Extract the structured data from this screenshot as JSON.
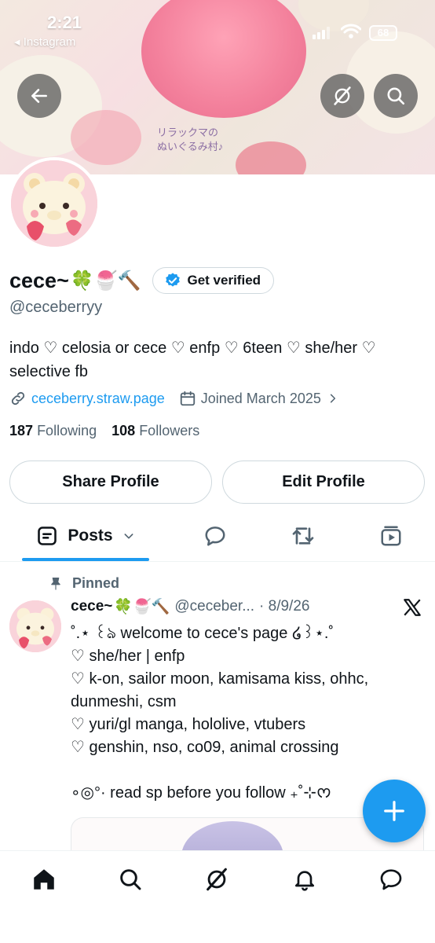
{
  "status_bar": {
    "time": "2:21",
    "back_app": "◂ Instagram",
    "battery": "68"
  },
  "banner": {
    "caption": "リラックマの\nぬいぐるみ村♪"
  },
  "profile": {
    "name": "cece~",
    "name_emojis": "🍀🍧🔨",
    "verify_label": "Get verified",
    "handle": "@ceceberryy",
    "bio": "indo ♡ celosia or cece ♡ enfp ♡ 6teen ♡ she/her ♡ selective fb",
    "link": "ceceberry.straw.page",
    "joined": "Joined March 2025",
    "following_count": "187",
    "following_label": "Following",
    "followers_count": "108",
    "followers_label": "Followers"
  },
  "buttons": {
    "share": "Share Profile",
    "edit": "Edit Profile"
  },
  "tabs": {
    "posts": "Posts"
  },
  "post": {
    "pinned_label": "Pinned",
    "author_name": "cece~",
    "author_emojis": "🍀🍧🔨",
    "author_handle": "@ceceber...",
    "date": "· 8/9/26",
    "body": "˚.⋆ ꒰ঌ welcome to cece's page ໒꒱⋆.˚\n♡ she/her | enfp\n♡ k-on, sailor moon, kamisama kiss, ohhc, dunmeshi, csm\n♡ yuri/gl manga, hololive, vtubers\n♡ genshin, nso, co09, animal crossing\n\n∘◎°· read sp before you follow ₊˚⊹ᰔ"
  },
  "icons": {
    "back": "back-arrow-icon",
    "grok": "grok-icon",
    "search": "search-icon",
    "verified": "verified-badge-icon",
    "link": "link-icon",
    "calendar": "calendar-icon",
    "home": "home-icon",
    "notifications": "bell-icon",
    "messages": "message-icon",
    "compose": "plus-icon"
  },
  "colors": {
    "accent": "#1d9bf0",
    "text": "#0f1419",
    "muted": "#536471"
  }
}
